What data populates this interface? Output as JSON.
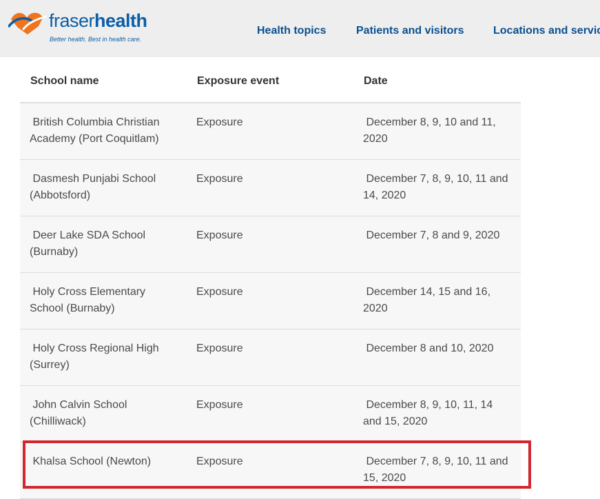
{
  "header": {
    "logo": {
      "word_light": "fraser",
      "word_bold": "health",
      "tagline": "Better health. Best in health care."
    },
    "nav": [
      {
        "label": "Health topics"
      },
      {
        "label": "Patients and visitors"
      },
      {
        "label": "Locations and services"
      }
    ]
  },
  "table": {
    "columns": [
      "School name",
      "Exposure event",
      "Date"
    ],
    "rows": [
      {
        "school": " British Columbia Christian Academy (Port Coquitlam)",
        "event": "Exposure",
        "date": " December 8, 9, 10 and 11, 2020"
      },
      {
        "school": " Dasmesh Punjabi School (Abbotsford)",
        "event": "Exposure",
        "date": " December 7, 8, 9, 10, 11 and 14, 2020"
      },
      {
        "school": " Deer Lake SDA School (Burnaby)",
        "event": "Exposure",
        "date": " December 7, 8 and 9, 2020"
      },
      {
        "school": " Holy Cross Elementary School (Burnaby)",
        "event": "Exposure",
        "date": " December 14, 15 and 16, 2020"
      },
      {
        "school": " Holy Cross Regional High (Surrey)",
        "event": "Exposure",
        "date": " December 8 and 10, 2020"
      },
      {
        "school": " John Calvin School (Chilliwack)",
        "event": "Exposure",
        "date": " December 8, 9, 10, 11, 14 and 15, 2020"
      },
      {
        "school": " Khalsa School (Newton)",
        "event": "Exposure",
        "date": " December 7, 8, 9, 10, 11 and 15, 2020"
      }
    ]
  },
  "colors": {
    "brand_blue": "#0a5ea8",
    "brand_orange": "#f0731e",
    "highlight_red": "#d22630",
    "header_bg": "#eeeeee"
  }
}
